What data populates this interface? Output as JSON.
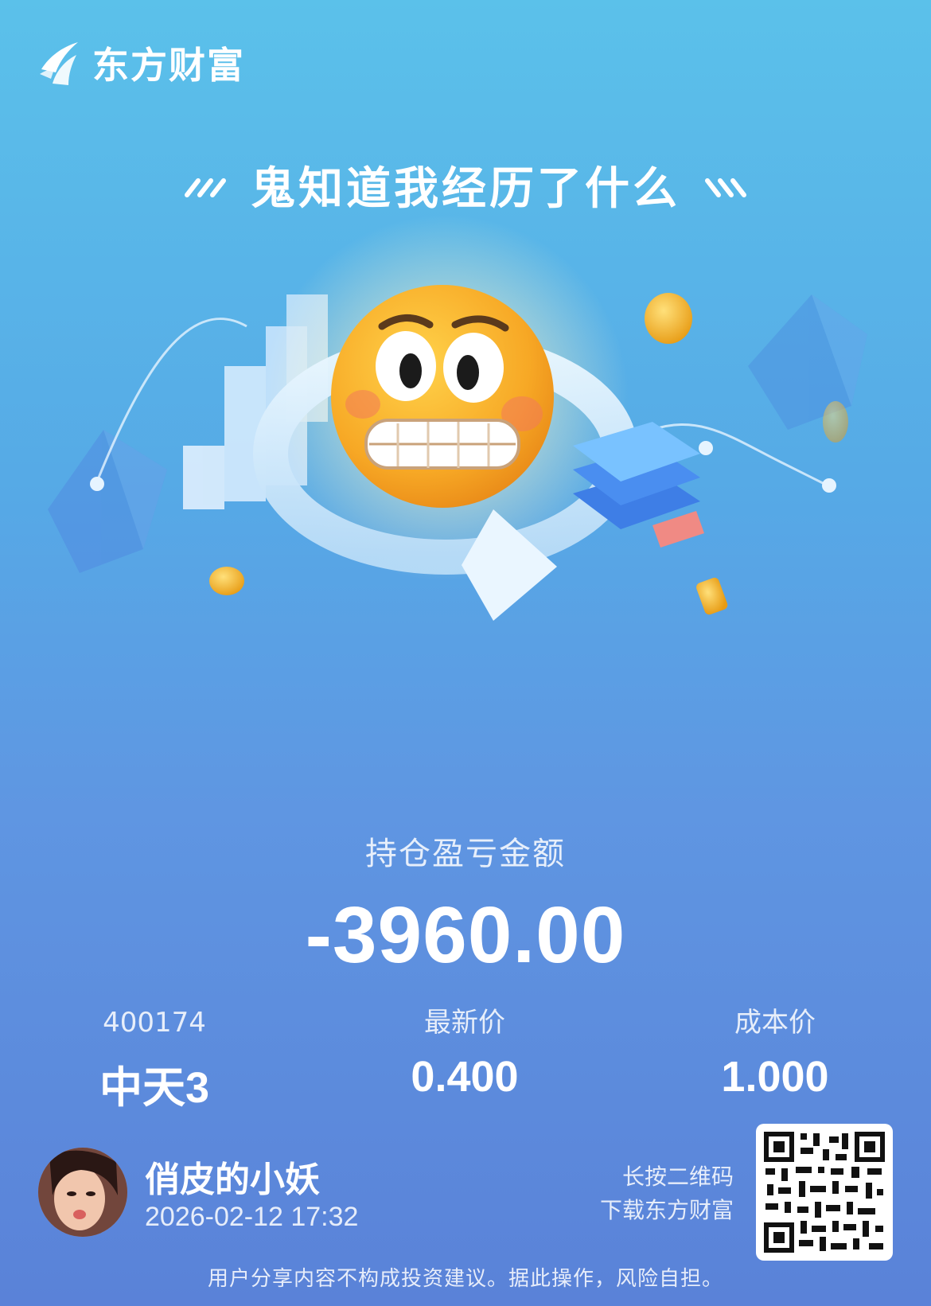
{
  "brand": {
    "name": "东方财富",
    "logo_icon": "eastmoney-logo-icon"
  },
  "headline": {
    "text": "鬼知道我经历了什么"
  },
  "hero": {
    "icon": "grimacing-face-icon"
  },
  "pnl": {
    "label": "持仓盈亏金额",
    "value": "-3960.00"
  },
  "stock": {
    "code": "400174",
    "name": "中天3",
    "last_price_label": "最新价",
    "last_price": "0.400",
    "cost_price_label": "成本价",
    "cost_price": "1.000"
  },
  "user": {
    "name": "俏皮的小妖",
    "timestamp": "2026-02-12 17:32"
  },
  "qr": {
    "hint_line1": "长按二维码",
    "hint_line2": "下载东方财富"
  },
  "footer": {
    "disclaimer": "用户分享内容不构成投资建议。据此操作，风险自担。"
  },
  "colors": {
    "background_top": "#5bc1ea",
    "background_bottom": "#5a82d8",
    "text": "#ffffff",
    "coin": "#f5b52a"
  }
}
